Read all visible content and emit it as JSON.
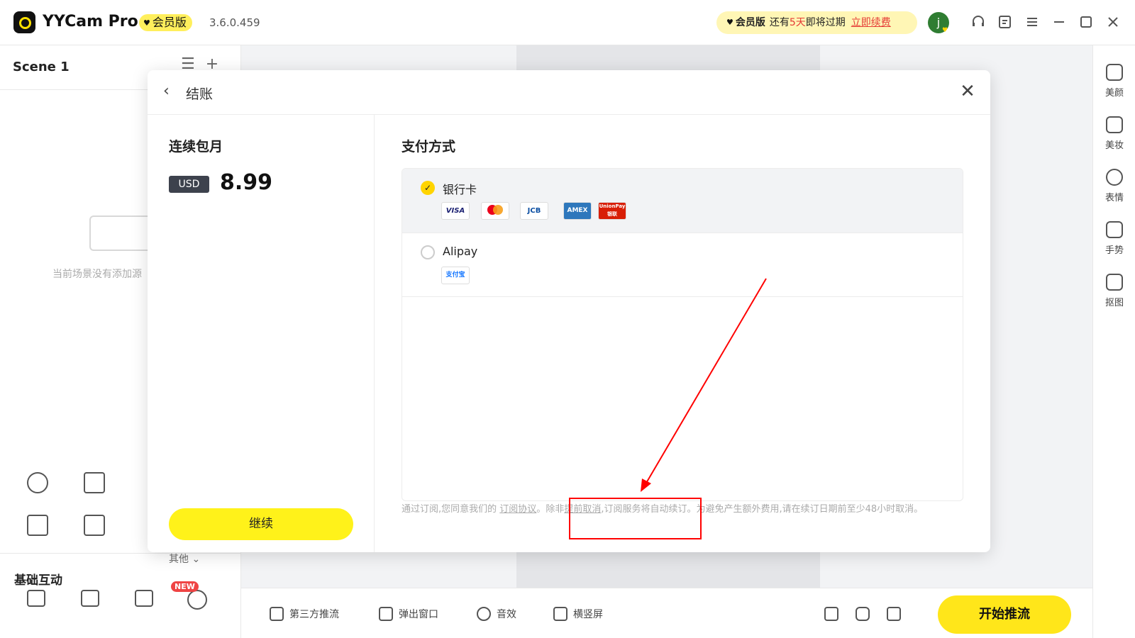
{
  "titlebar": {
    "app_name": "YYCam Pro",
    "vip_badge": "会员版",
    "version": "3.6.0.459",
    "renew": {
      "vip_label": "会员版",
      "prefix": "还有",
      "days": "5天",
      "suffix": "即将过期",
      "link": "立即续费"
    },
    "avatar_letter": "j",
    "icons": [
      "headset-icon",
      "feedback-icon",
      "menu-icon",
      "minimize-icon",
      "maximize-icon",
      "close-icon"
    ]
  },
  "scene": {
    "title": "Scene 1",
    "empty_text": "当前场景没有添加源"
  },
  "basic": {
    "title": "基础互动",
    "new_tag": "NEW"
  },
  "right_tools": [
    {
      "label": "美颜",
      "icon": "beauty-icon"
    },
    {
      "label": "美妆",
      "icon": "makeup-icon"
    },
    {
      "label": "表情",
      "icon": "emoji-icon"
    },
    {
      "label": "手势",
      "icon": "gesture-icon"
    },
    {
      "label": "抠图",
      "icon": "cutout-icon"
    }
  ],
  "bottom": {
    "third_party": "第三方推流",
    "popup": "弹出窗口",
    "sound": "音效",
    "orientation": "横竖屏",
    "start": "开始推流"
  },
  "checkout": {
    "title": "结账",
    "plan": {
      "name": "连续包月",
      "currency": "USD",
      "price": "8.99",
      "continue": "继续",
      "other": "其他"
    },
    "payment": {
      "title": "支付方式",
      "options": [
        {
          "label": "银行卡",
          "selected": true,
          "brands": [
            "VISA",
            "mastercard",
            "JCB",
            "AMEX",
            "UnionPay 银联"
          ]
        },
        {
          "label": "Alipay",
          "selected": false,
          "brands": [
            "支付宝"
          ]
        }
      ]
    },
    "agreement": {
      "part1": "通过订阅,您同意我们的",
      "link1": "订阅协议",
      "part2": "。",
      "part3": "除非",
      "link2": "提前取消",
      "part4": ",订阅服务将自动续订。为避免产生额外费用,请在续订日期前至少48小时取消。"
    }
  },
  "colors": {
    "accent": "#ffe61a",
    "vip_yellow": "#ffef5c",
    "warning_red": "#e53935",
    "annotation_red": "#ff0000"
  }
}
